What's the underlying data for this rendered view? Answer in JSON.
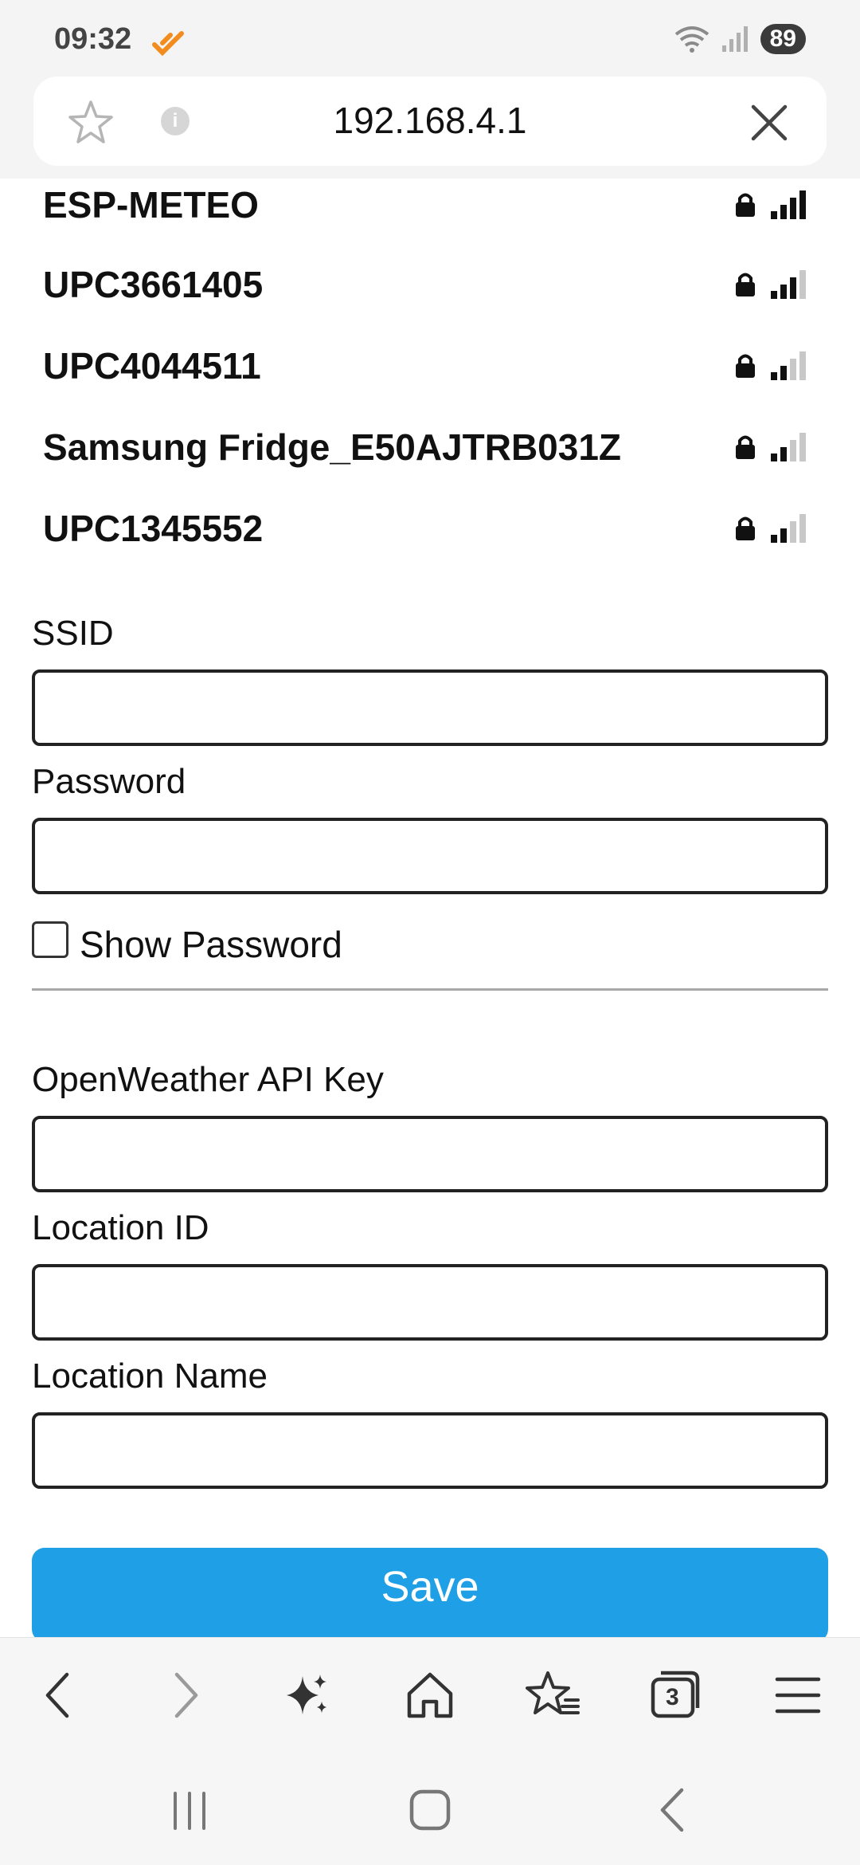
{
  "status_bar": {
    "time": "09:32",
    "battery": "89",
    "icons": [
      "notification-app-icon",
      "wifi-icon",
      "signal-icon",
      "battery-icon"
    ]
  },
  "address_bar": {
    "url": "192.168.4.1",
    "icons": [
      "star-icon",
      "info-icon",
      "close-icon"
    ],
    "info_glyph": "i"
  },
  "networks": [
    {
      "ssid": "ESP-METEO",
      "locked": true,
      "signal_bars": 4
    },
    {
      "ssid": "UPC3661405",
      "locked": true,
      "signal_bars": 3
    },
    {
      "ssid": "UPC4044511",
      "locked": true,
      "signal_bars": 2
    },
    {
      "ssid": "Samsung Fridge_E50AJTRB031Z",
      "locked": true,
      "signal_bars": 2
    },
    {
      "ssid": "UPC1345552",
      "locked": true,
      "signal_bars": 2
    }
  ],
  "form": {
    "ssid_label": "SSID",
    "ssid_value": "",
    "password_label": "Password",
    "password_value": "",
    "show_password_label": "Show Password",
    "show_password_checked": false,
    "api_key_label": "OpenWeather API Key",
    "api_key_value": "",
    "location_id_label": "Location ID",
    "location_id_value": "",
    "location_name_label": "Location Name",
    "location_name_value": "",
    "save_label": "Save"
  },
  "toolbar": {
    "items": [
      "back-icon",
      "forward-icon",
      "sparkle-icon",
      "home-icon",
      "bookmarks-icon",
      "tabs-icon",
      "menu-icon"
    ],
    "tabs_count": "3"
  },
  "system_nav": [
    "recents-icon",
    "home-icon",
    "back-icon"
  ],
  "colors": {
    "accent": "#1f9fe6",
    "chrome_bg": "#f4f4f4",
    "brand_orange": "#f28c1e"
  }
}
